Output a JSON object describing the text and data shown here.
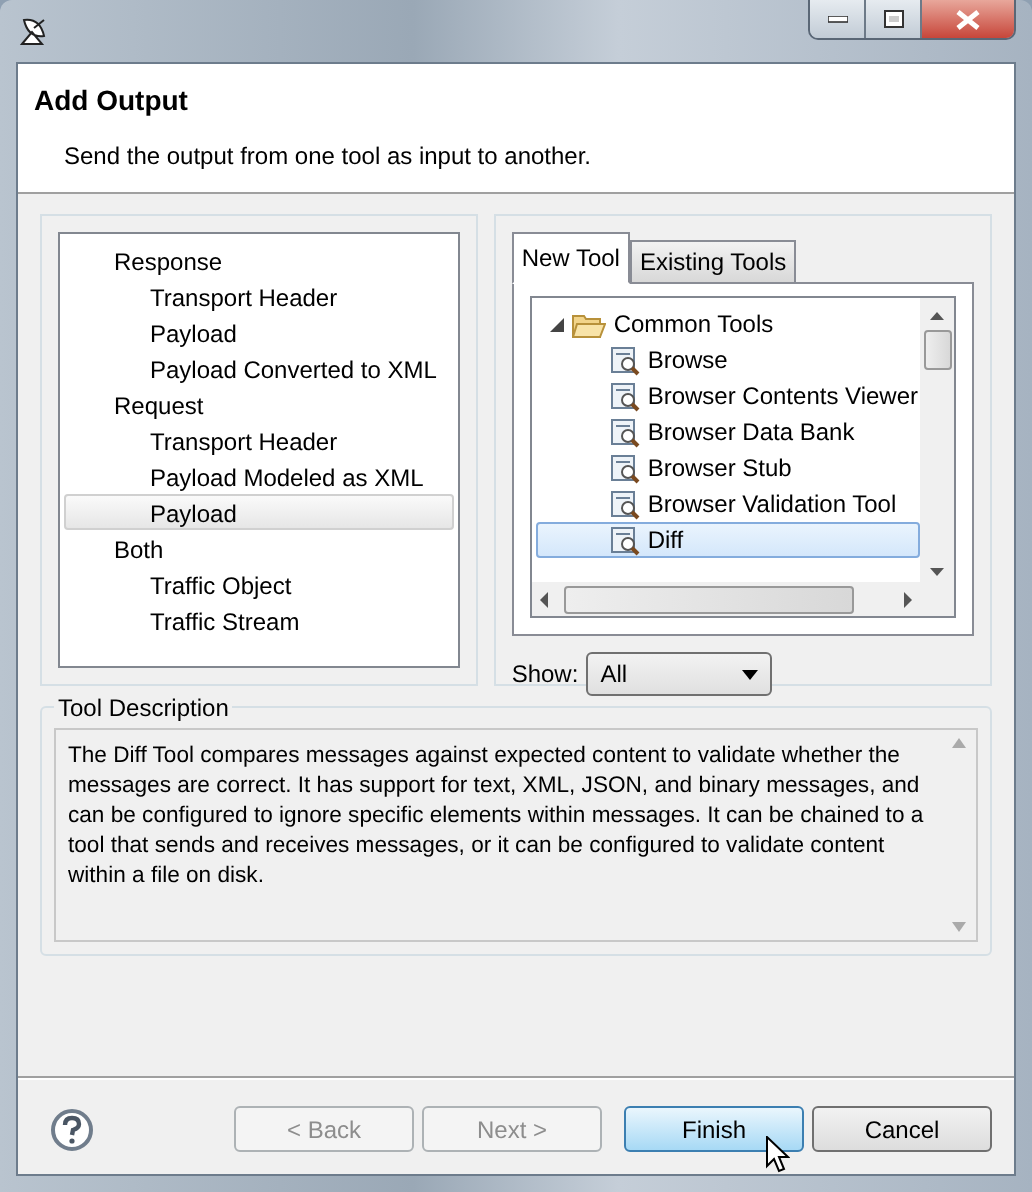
{
  "header": {
    "title": "Add Output",
    "description": "Send the output from one tool as input to another."
  },
  "output_tree": [
    {
      "label": "Response",
      "selected": false,
      "children": [
        {
          "label": "Transport Header",
          "selected": false
        },
        {
          "label": "Payload",
          "selected": false
        },
        {
          "label": "Payload Converted to XML",
          "selected": false
        }
      ]
    },
    {
      "label": "Request",
      "selected": false,
      "children": [
        {
          "label": "Transport Header",
          "selected": false
        },
        {
          "label": "Payload Modeled as XML",
          "selected": false
        },
        {
          "label": "Payload",
          "selected": true
        }
      ]
    },
    {
      "label": "Both",
      "selected": false,
      "children": [
        {
          "label": "Traffic Object",
          "selected": false
        },
        {
          "label": "Traffic Stream",
          "selected": false
        }
      ]
    }
  ],
  "tool_panel": {
    "tabs": [
      {
        "label": "New Tool",
        "selected": true
      },
      {
        "label": "Existing Tools",
        "selected": false
      }
    ],
    "tree": [
      {
        "label": "Common Tools",
        "expanded": true,
        "selected": false,
        "children": [
          {
            "label": "Browse",
            "selected": false
          },
          {
            "label": "Browser Contents Viewer",
            "selected": false
          },
          {
            "label": "Browser Data Bank",
            "selected": false
          },
          {
            "label": "Browser Stub",
            "selected": false
          },
          {
            "label": "Browser Validation Tool",
            "selected": false
          },
          {
            "label": "Diff",
            "selected": true
          }
        ]
      }
    ],
    "show": {
      "label": "Show:",
      "value": "All"
    }
  },
  "tool_description": {
    "title": "Tool Description",
    "text": "The Diff Tool compares messages against expected content to validate whether the messages are correct. It has support for text, XML, JSON, and binary messages, and can be configured to ignore specific elements within messages. It can be chained to a tool that sends and receives messages, or it can be configured to validate content within a file on disk."
  },
  "buttons": [
    {
      "label": "< Back",
      "disabled": true,
      "default": false
    },
    {
      "label": "Next >",
      "disabled": true,
      "default": false
    },
    {
      "label": "Finish",
      "disabled": false,
      "default": true
    },
    {
      "label": "Cancel",
      "disabled": false,
      "default": false
    }
  ]
}
